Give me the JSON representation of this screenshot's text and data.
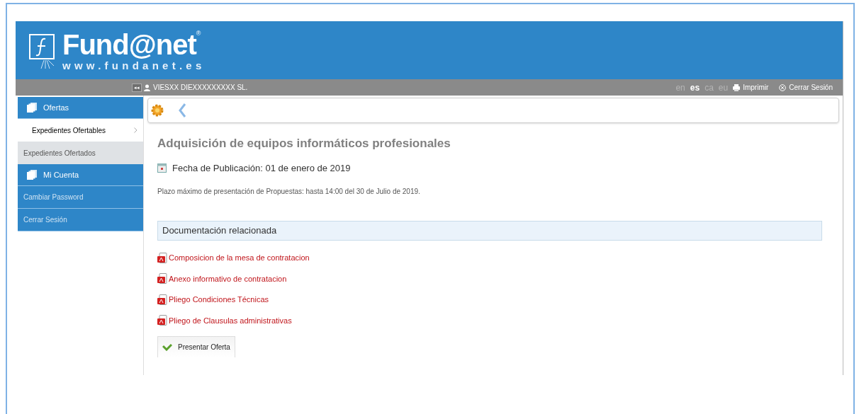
{
  "header": {
    "logo_text": "Fund@net",
    "logo_mark": "®",
    "logo_url": "www.fundanet.es"
  },
  "user_bar": {
    "collapse": "◂◂",
    "user": "VIESXX DIEXXXXXXXXX SL.",
    "languages": [
      {
        "label": "en",
        "selected": false
      },
      {
        "label": "es",
        "selected": true
      },
      {
        "label": "ca",
        "selected": false
      },
      {
        "label": "eu",
        "selected": false
      }
    ],
    "print": "Imprimir",
    "logout": "Cerrar Sesión"
  },
  "sidebar": {
    "items": [
      {
        "kind": "section",
        "label": "Ofertas"
      },
      {
        "kind": "subitem",
        "label": "Expedientes Ofertables",
        "selected": true
      },
      {
        "kind": "subitem",
        "label": "Expedientes Ofertados",
        "selected": false
      },
      {
        "kind": "section",
        "label": "Mi Cuenta"
      },
      {
        "kind": "link",
        "label": "Cambiar Password",
        "selected": false
      },
      {
        "kind": "link",
        "label": "Cerrar Sesión",
        "selected": false
      }
    ]
  },
  "content": {
    "title": "Adquisición de equipos informáticos profesionales",
    "publication": "Fecha de Publicación: 01 de enero de 2019",
    "deadline": "Plazo máximo de presentación de Propuestas: hasta 14:00 del 30 de Julio de 2019.",
    "docs_heading": "Documentación relacionada",
    "documents": [
      "Composicion de la mesa de contratacion",
      "Anexo informativo de contratacion",
      "Pliego Condiciones Técnicas",
      "Pliego de Clausulas administrativas"
    ],
    "submit_button": "Presentar Oferta"
  }
}
